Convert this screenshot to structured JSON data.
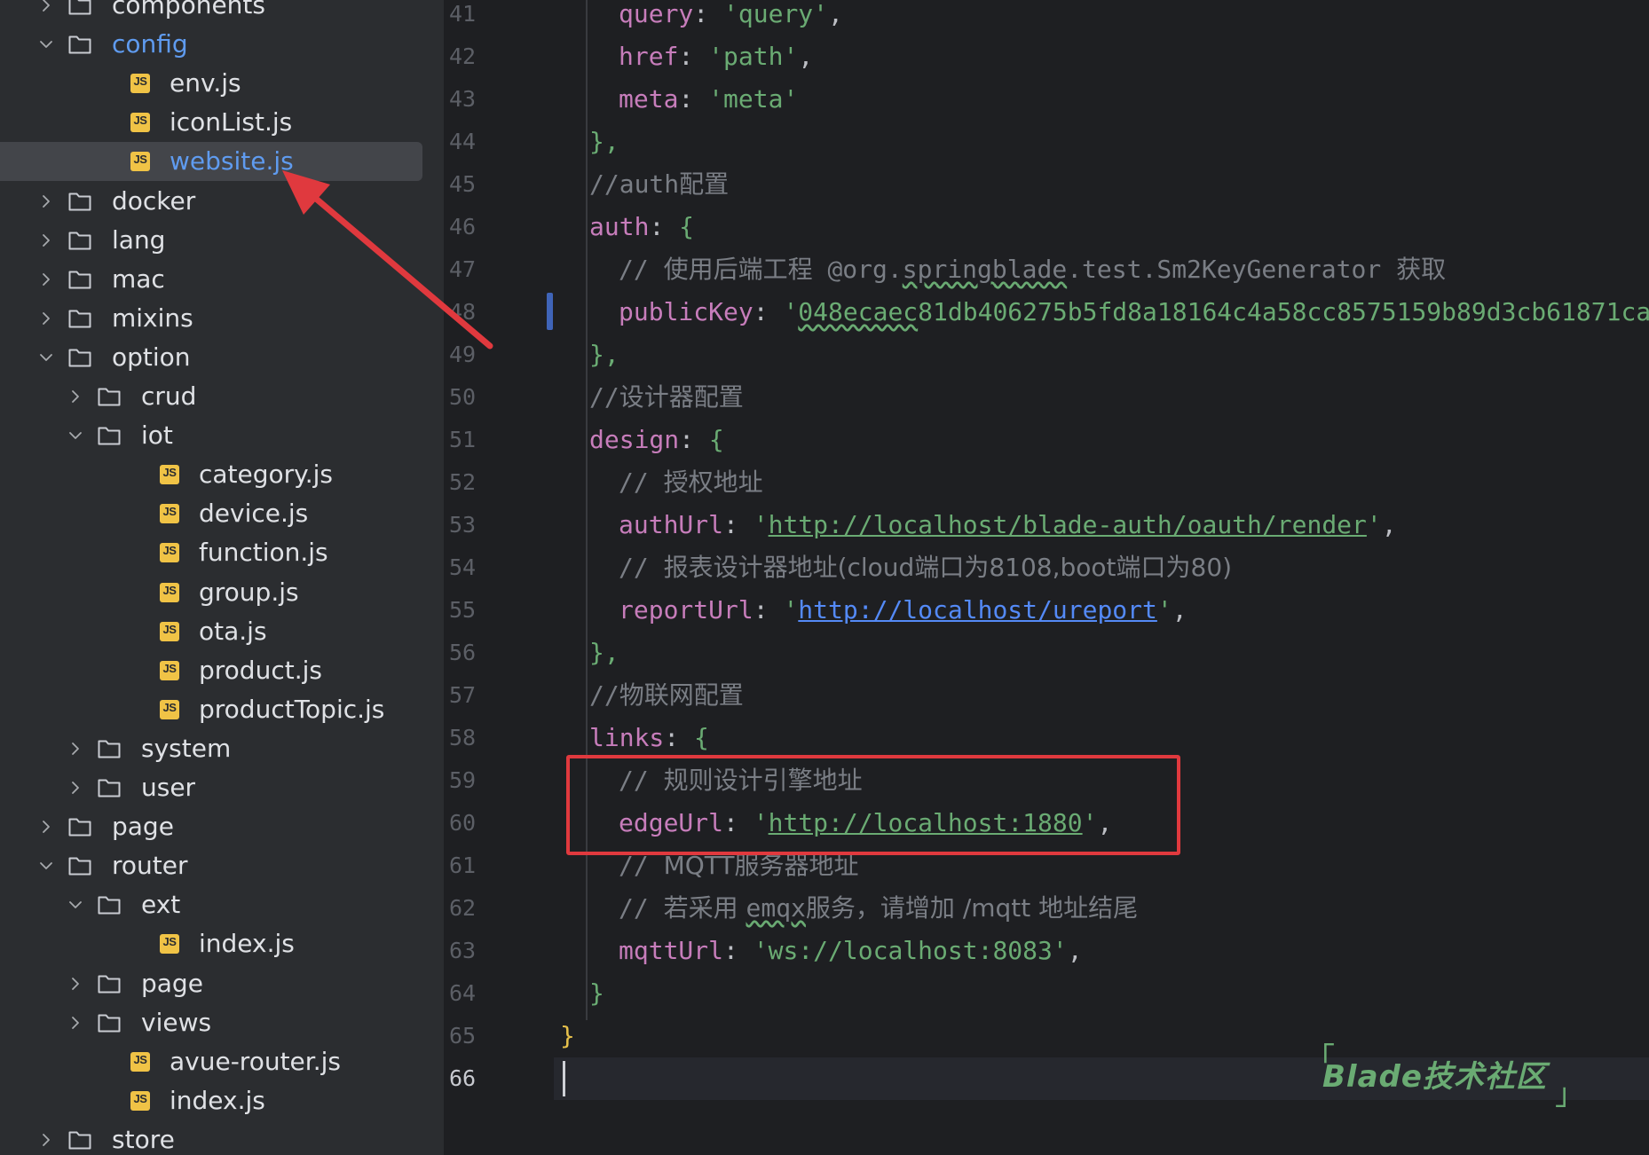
{
  "tree": {
    "items": [
      {
        "name": "components",
        "type": "folder",
        "state": "collapsed"
      },
      {
        "name": "config",
        "type": "folder",
        "state": "expanded"
      },
      {
        "name": "env.js",
        "type": "js"
      },
      {
        "name": "iconList.js",
        "type": "js"
      },
      {
        "name": "website.js",
        "type": "js",
        "selected": true
      },
      {
        "name": "docker",
        "type": "folder",
        "state": "collapsed"
      },
      {
        "name": "lang",
        "type": "folder",
        "state": "collapsed"
      },
      {
        "name": "mac",
        "type": "folder",
        "state": "collapsed"
      },
      {
        "name": "mixins",
        "type": "folder",
        "state": "collapsed"
      },
      {
        "name": "option",
        "type": "folder",
        "state": "expanded"
      },
      {
        "name": "crud",
        "type": "folder",
        "state": "collapsed"
      },
      {
        "name": "iot",
        "type": "folder",
        "state": "expanded"
      },
      {
        "name": "category.js",
        "type": "js"
      },
      {
        "name": "device.js",
        "type": "js"
      },
      {
        "name": "function.js",
        "type": "js"
      },
      {
        "name": "group.js",
        "type": "js"
      },
      {
        "name": "ota.js",
        "type": "js"
      },
      {
        "name": "product.js",
        "type": "js"
      },
      {
        "name": "productTopic.js",
        "type": "js"
      },
      {
        "name": "system",
        "type": "folder",
        "state": "collapsed"
      },
      {
        "name": "user",
        "type": "folder",
        "state": "collapsed"
      },
      {
        "name": "page",
        "type": "folder",
        "state": "collapsed"
      },
      {
        "name": "router",
        "type": "folder",
        "state": "expanded"
      },
      {
        "name": "ext",
        "type": "folder",
        "state": "expanded"
      },
      {
        "name": "index.js",
        "type": "js"
      },
      {
        "name": "page",
        "type": "folder",
        "state": "collapsed"
      },
      {
        "name": "views",
        "type": "folder",
        "state": "collapsed"
      },
      {
        "name": "avue-router.js",
        "type": "js"
      },
      {
        "name": "index.js",
        "type": "js"
      },
      {
        "name": "store",
        "type": "folder",
        "state": "collapsed"
      }
    ]
  },
  "editor": {
    "line_numbers": [
      "41",
      "42",
      "43",
      "44",
      "45",
      "46",
      "47",
      "48",
      "49",
      "50",
      "51",
      "52",
      "53",
      "54",
      "55",
      "56",
      "57",
      "58",
      "59",
      "60",
      "61",
      "62",
      "63",
      "64",
      "65",
      "66"
    ],
    "current_line": "66",
    "lines": {
      "l41": {
        "key": "query",
        "val": "'query'",
        "tail": ","
      },
      "l42": {
        "key": "href",
        "val": "'path'",
        "tail": ","
      },
      "l43": {
        "key": "meta",
        "val": "'meta'"
      },
      "l44": {
        "text": "},"
      },
      "l45": {
        "comment_prefix": "//auth",
        "comment_cn": "配置"
      },
      "l46": {
        "key": "auth"
      },
      "l47": {
        "prefix": "// ",
        "cn": "使用后端工程",
        "mid": " @org.",
        "wavy": "springblade",
        "rest": ".test.Sm2KeyGenerator ",
        "cn2": "获取"
      },
      "l48": {
        "key": "publicKey",
        "q": "'",
        "wavy": "048ecaec",
        "rest": "81db406275b5fd8a18164c4a58cc8575159b89d3cb61871ca"
      },
      "l49": {
        "text": "},"
      },
      "l50": {
        "comment_prefix": "//",
        "comment_cn": "设计器配置"
      },
      "l51": {
        "key": "design"
      },
      "l52": {
        "prefix": "// ",
        "cn": "授权地址"
      },
      "l53": {
        "key": "authUrl",
        "url": "http://localhost/blade-auth/oauth/render"
      },
      "l54": {
        "prefix": "// ",
        "cn": "报表设计器地址(cloud端口为8108,boot端口为80)"
      },
      "l55": {
        "key": "reportUrl",
        "url": "http://localhost/ureport"
      },
      "l56": {
        "text": "},"
      },
      "l57": {
        "comment_prefix": "//",
        "comment_cn": "物联网配置"
      },
      "l58": {
        "key": "links"
      },
      "l59": {
        "prefix": "// ",
        "cn": "规则设计引擎地址"
      },
      "l60": {
        "key": "edgeUrl",
        "url": "http://localhost:1880"
      },
      "l61": {
        "prefix": "// ",
        "cn": "MQTT服务器地址"
      },
      "l62": {
        "prefix": "// ",
        "cn": "若采用 ",
        "wavy": "emqx",
        "cn2": "服务，请增加 /mqtt 地址结尾"
      },
      "l63": {
        "key": "mqttUrl",
        "val": "'ws://localhost:8083'",
        "tail": ","
      },
      "l64": {
        "text": "}"
      },
      "l65": {
        "text": "}"
      }
    }
  },
  "watermark": {
    "text": "Blade技术社区",
    "open": "「",
    "close": "」"
  },
  "colors": {
    "annotation": "#e0393e",
    "string": "#6aab73",
    "keyword": "#c77dbb",
    "link": "#548af7",
    "folder_selected": "#5f9bef"
  }
}
